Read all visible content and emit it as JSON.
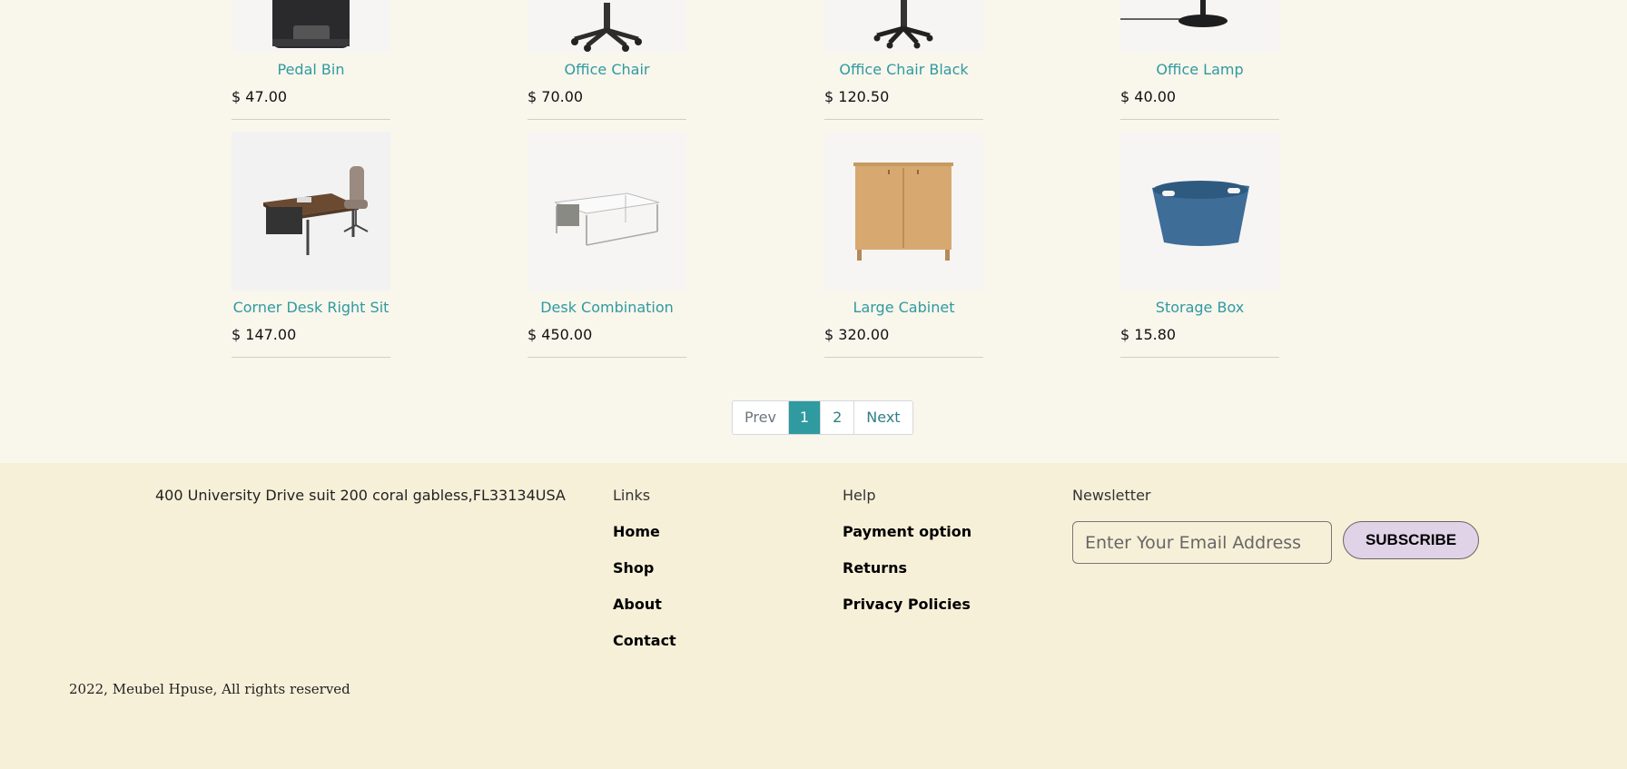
{
  "products": [
    {
      "name": "Pedal Bin",
      "price": "$ 47.00",
      "icon": "pedal-bin-image"
    },
    {
      "name": "Office Chair",
      "price": "$ 70.00",
      "icon": "office-chair-image"
    },
    {
      "name": "Office Chair Black",
      "price": "$ 120.50",
      "icon": "office-chair-black-image"
    },
    {
      "name": "Office Lamp",
      "price": "$ 40.00",
      "icon": "office-lamp-image"
    },
    {
      "name": "Corner Desk Right Sit",
      "price": "$ 147.00",
      "icon": "corner-desk-image"
    },
    {
      "name": "Desk Combination",
      "price": "$ 450.00",
      "icon": "desk-combination-image"
    },
    {
      "name": "Large Cabinet",
      "price": "$ 320.00",
      "icon": "large-cabinet-image"
    },
    {
      "name": "Storage Box",
      "price": "$ 15.80",
      "icon": "storage-box-image"
    }
  ],
  "pagination": {
    "prev": "Prev",
    "pages": [
      "1",
      "2"
    ],
    "current": "1",
    "next": "Next"
  },
  "footer": {
    "address": "400 University Drive suit 200 coral gabless,FL33134USA",
    "links": {
      "heading": "Links",
      "items": [
        "Home",
        "Shop",
        "About",
        "Contact"
      ]
    },
    "help": {
      "heading": "Help",
      "items": [
        "Payment option",
        "Returns",
        "Privacy Policies"
      ]
    },
    "newsletter": {
      "heading": "Newsletter",
      "placeholder": "Enter Your Email Address",
      "button": "SUBSCRIBE"
    },
    "copyright": "2022, Meubel Hpuse, All rights reserved"
  },
  "colors": {
    "accent": "#2f9aa0",
    "page_bg": "#f9f6ec",
    "footer_bg": "#f7f0d8",
    "subscribe_bg": "#e0d3e8"
  }
}
